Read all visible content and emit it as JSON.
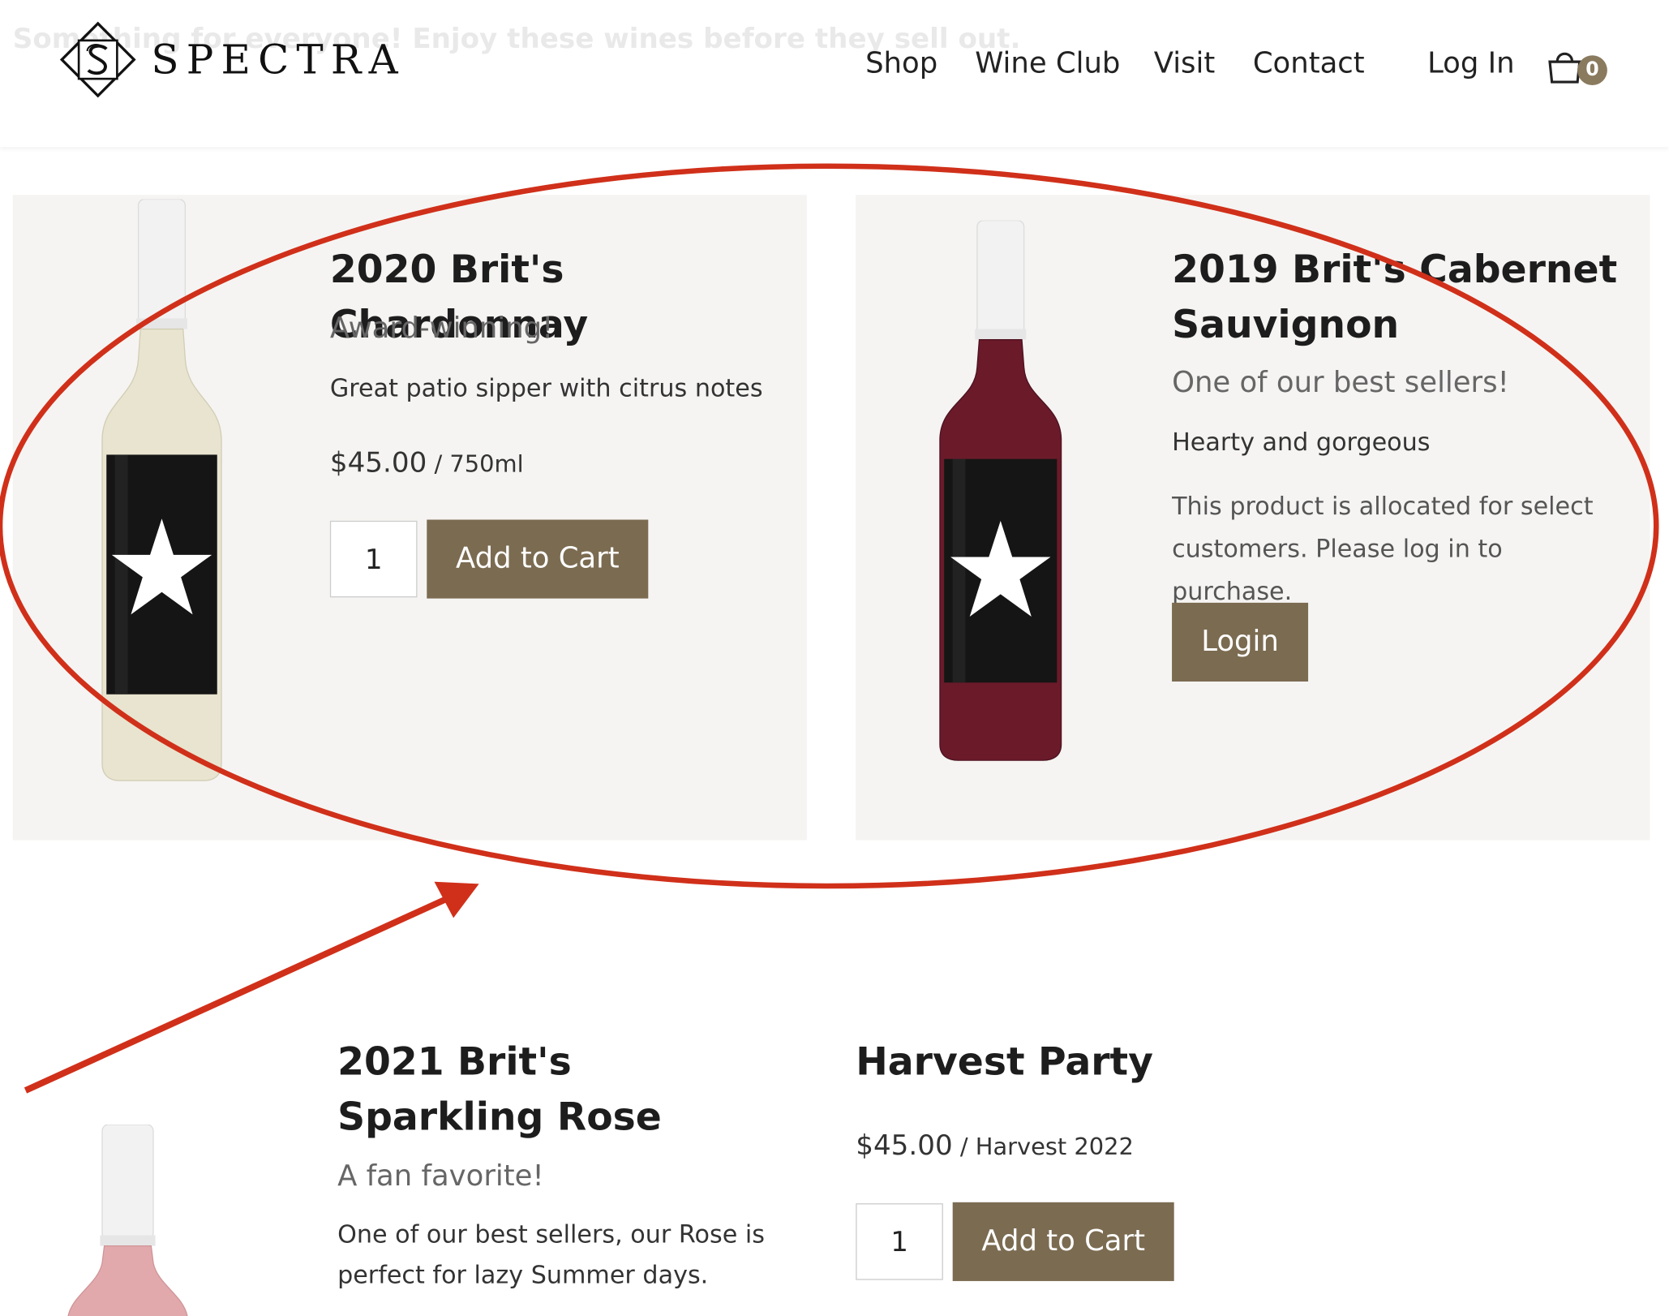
{
  "header": {
    "banner_text": "Something for everyone! Enjoy these wines before they sell out.",
    "logo_text": "SPECTRA",
    "nav": [
      "Shop",
      "Wine Club",
      "Visit",
      "Contact"
    ],
    "login_label": "Log In",
    "cart_count": "0"
  },
  "products": {
    "chardonnay": {
      "title": "2020 Brit's Chardonnay",
      "tagline": "Award-winning!",
      "description": "Great patio sipper with citrus notes",
      "price": "$45.00",
      "unit": " / 750ml",
      "quantity": "1",
      "button": "Add to Cart",
      "bottle_color": "#e8e4cf"
    },
    "cabernet": {
      "title": "2019 Brit's Cabernet Sauvignon",
      "tagline": "One of our best sellers!",
      "description": "Hearty and gorgeous",
      "notice": "This product is allocated for select customers. Please log in to purchase.",
      "button": "Login",
      "bottle_color": "#6b1a2a"
    },
    "rose": {
      "title": "2021 Brit's Sparkling Rose",
      "tagline": "A fan favorite!",
      "description": "One of our best sellers, our Rose is perfect for lazy Summer days.",
      "bottle_color": "#e2a9ac"
    },
    "harvest": {
      "title": "Harvest Party",
      "price": "$45.00",
      "unit": " / Harvest 2022",
      "quantity": "1",
      "button": "Add to Cart"
    }
  },
  "colors": {
    "button": "#7b6b51",
    "card_bg": "#f5f4f2",
    "annotation": "#d0301a"
  }
}
